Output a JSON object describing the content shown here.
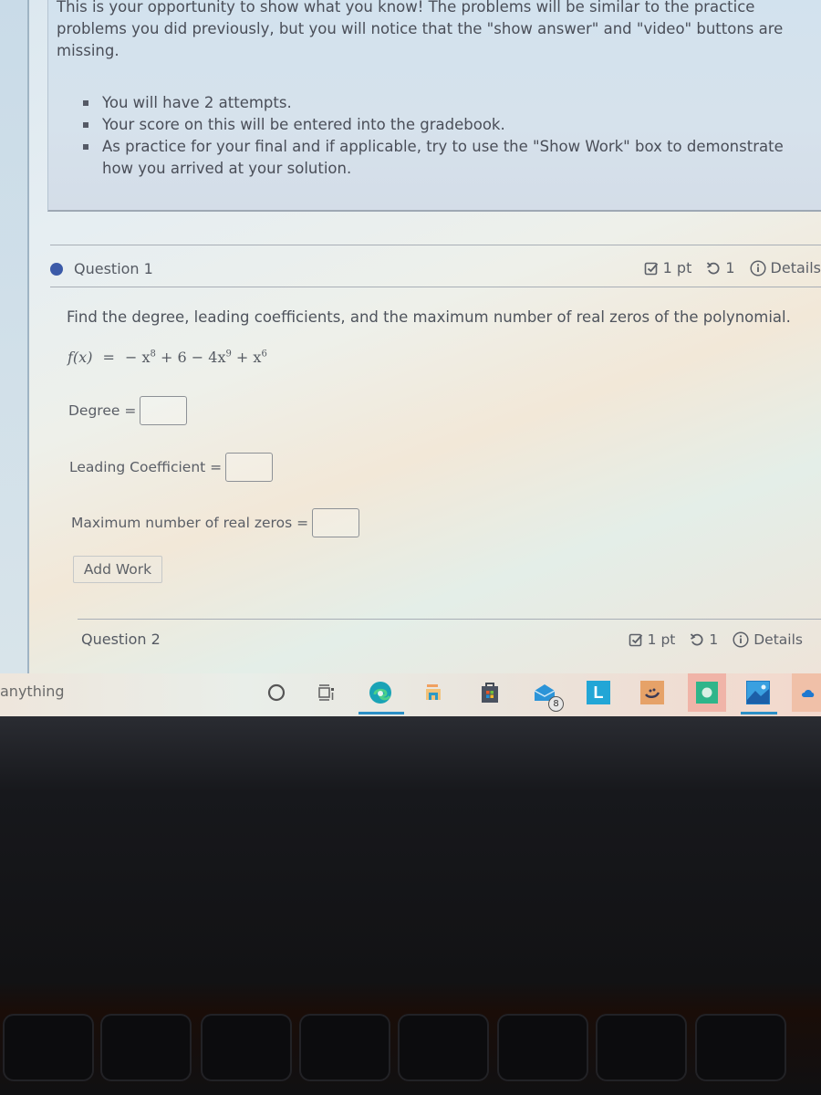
{
  "intro": {
    "text": "This is your opportunity to show what you know! The problems will be similar to the practice problems you did previously, but you will notice that the \"show answer\" and \"video\" buttons are missing.",
    "bullets": [
      "You will have 2 attempts.",
      "Your score on this will be entered into the gradebook.",
      "As practice for your final and if applicable, try to use the \"Show Work\" box to demonstrate how you arrived at your solution."
    ]
  },
  "question1": {
    "title": "Question 1",
    "points": "1 pt",
    "attempts": "1",
    "details_label": "Details",
    "prompt": "Find the degree, leading coefficients, and the maximum number of real zeros of the polynomial.",
    "formula": {
      "lhs": "f(x)",
      "equals": "=",
      "terms": [
        "− x",
        "8",
        " + 6 − 4x",
        "9",
        " + x",
        "6"
      ]
    },
    "fields": [
      {
        "label": "Degree =",
        "value": ""
      },
      {
        "label": "Leading Coefficient =",
        "value": ""
      },
      {
        "label": "Maximum number of real zeros =",
        "value": ""
      }
    ],
    "add_work_label": "Add Work"
  },
  "question2": {
    "title": "Question 2",
    "points": "1 pt",
    "attempts": "1",
    "details_label": "Details"
  },
  "taskbar": {
    "search_text": "anything",
    "apps": [
      {
        "name": "cortana",
        "icon": "circle-icon"
      },
      {
        "name": "task-view",
        "icon": "task-view-icon"
      },
      {
        "name": "edge",
        "icon": "edge-icon",
        "active": true
      },
      {
        "name": "file-explorer",
        "icon": "folder-icon"
      },
      {
        "name": "microsoft-store",
        "icon": "store-icon"
      },
      {
        "name": "mail",
        "icon": "mail-icon",
        "badge": "8"
      },
      {
        "name": "app-l",
        "icon": "l-app-icon",
        "letter": "L"
      },
      {
        "name": "app-orange",
        "icon": "hand-app-icon"
      },
      {
        "name": "app-green",
        "icon": "green-app-icon"
      },
      {
        "name": "photos",
        "icon": "photos-icon",
        "active": true
      },
      {
        "name": "onedrive",
        "icon": "cloud-icon"
      }
    ]
  },
  "colors": {
    "question_dot": "#3b5aa8",
    "text": "#4e535c",
    "taskbar_active": "#2b8fc6"
  }
}
